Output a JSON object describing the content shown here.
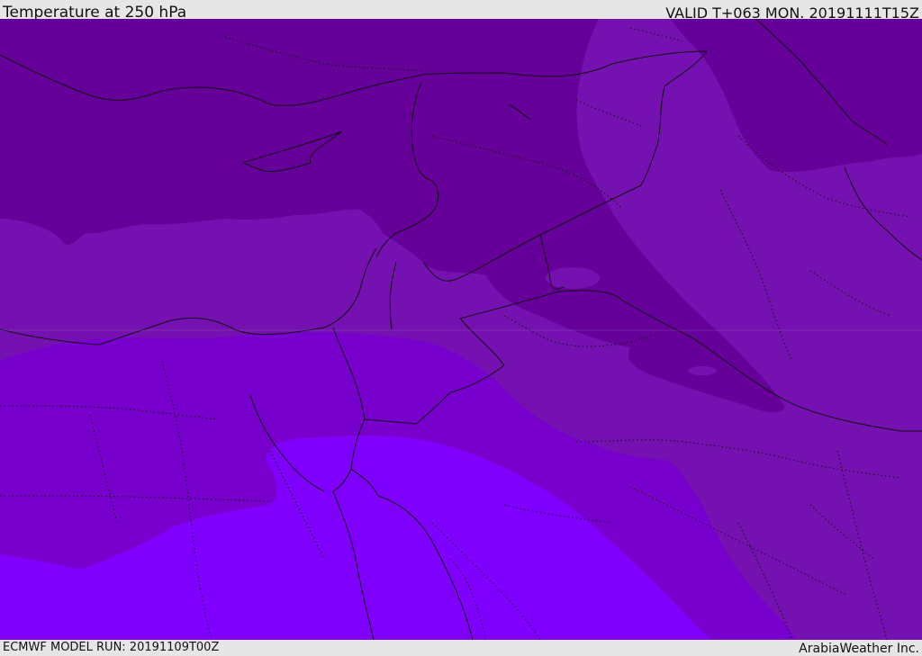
{
  "header": {
    "title": "Temperature at 250 hPa",
    "valid": "VALID T+063 MON. 20191111T15Z"
  },
  "footer": {
    "model_run": "ECMWF MODEL RUN: 20191109T00Z",
    "credit": "ArabiaWeather Inc."
  },
  "map": {
    "field": "temperature",
    "level": "250 hPa",
    "band_colors": [
      "#650099",
      "#7511b0",
      "#7700cc",
      "#8000ff"
    ],
    "border_color": "#111111",
    "admin_border_style": "dotted"
  }
}
